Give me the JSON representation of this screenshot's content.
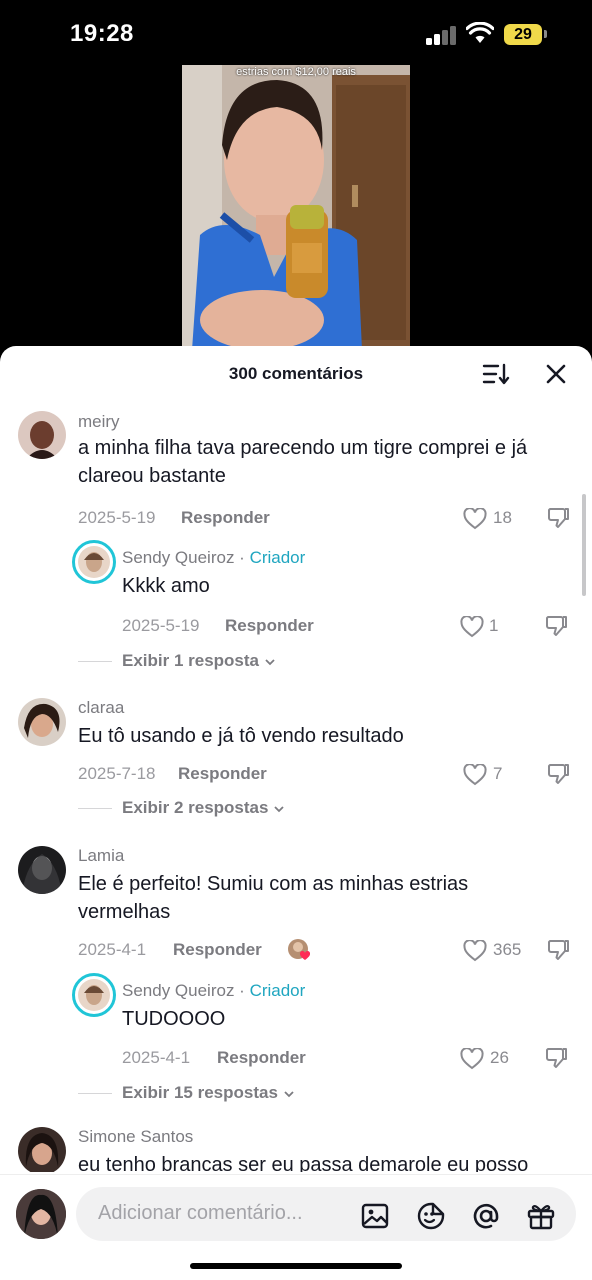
{
  "status_bar": {
    "time": "19:28",
    "battery": "29"
  },
  "video": {
    "caption": "estrias com $12,00 reais"
  },
  "sheet": {
    "title": "300 comentários"
  },
  "comments": [
    {
      "username": "meiry",
      "text": "a minha filha tava parecendo um tigre comprei e já clareou bastante",
      "date": "2025-5-19",
      "reply_label": "Responder",
      "likes": "18",
      "reply": {
        "username": "Sendy Queiroz",
        "badge": "Criador",
        "separator": " · ",
        "text": "Kkkk amo",
        "date": "2025-5-19",
        "reply_label": "Responder",
        "likes": "1"
      },
      "view_replies": "Exibir 1 resposta"
    },
    {
      "username": "claraa",
      "text": "Eu tô usando e já tô vendo resultado",
      "date": "2025-7-18",
      "reply_label": "Responder",
      "likes": "7",
      "view_replies": "Exibir 2 respostas"
    },
    {
      "username": "Lamia",
      "text": "Ele é perfeito! Sumiu com as minhas estrias vermelhas",
      "date": "2025-4-1",
      "reply_label": "Responder",
      "likes": "365",
      "reply": {
        "username": "Sendy Queiroz",
        "badge": "Criador",
        "separator": " · ",
        "text": "TUDOOOO",
        "date": "2025-4-1",
        "reply_label": "Responder",
        "likes": "26"
      },
      "view_replies": "Exibir 15 respostas"
    },
    {
      "username": "Simone Santos",
      "text": "eu tenho brancas ser eu passa demarole eu posso"
    }
  ],
  "bottom_bar": {
    "placeholder": "Adicionar comentário..."
  },
  "colors": {
    "accent": "#20c5d7",
    "creator_badge": "#20a6c0",
    "battery": "#f0d94a"
  }
}
